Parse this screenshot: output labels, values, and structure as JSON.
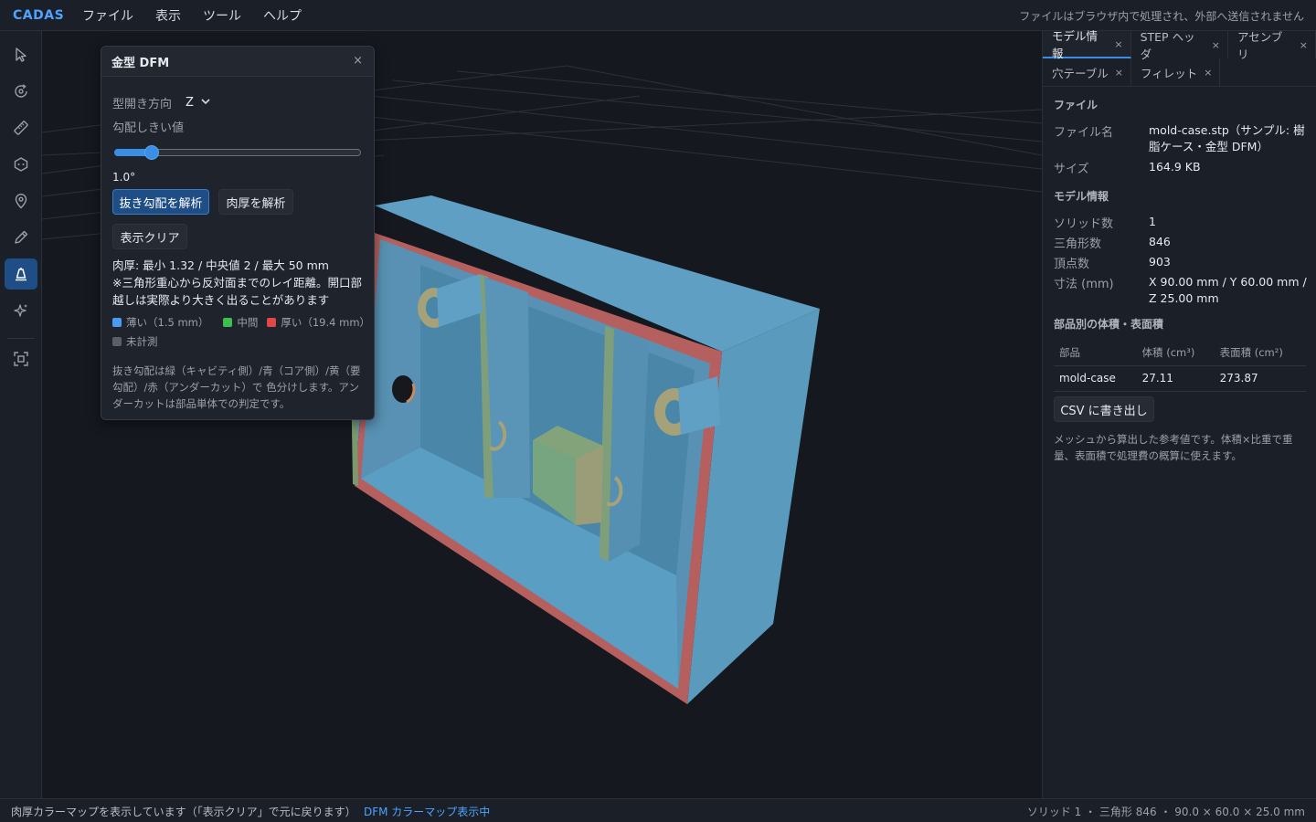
{
  "app": {
    "brand": "CADAS",
    "menus": [
      "ファイル",
      "表示",
      "ツール",
      "ヘルプ"
    ],
    "privacy_note": "ファイルはブラウザ内で処理され、外部へ送信されません"
  },
  "toolbar": {
    "tools": [
      {
        "name": "select-tool",
        "icon": "cursor-icon"
      },
      {
        "name": "orbit-tool",
        "icon": "orbit-icon"
      },
      {
        "name": "measure-tool",
        "icon": "ruler-icon"
      },
      {
        "name": "section-tool",
        "icon": "section-icon"
      },
      {
        "name": "marker-tool",
        "icon": "pin-icon"
      },
      {
        "name": "annotate-tool",
        "icon": "pencil-icon"
      },
      {
        "name": "dfm-tool",
        "icon": "mold-icon",
        "active": true
      },
      {
        "name": "ai-tool",
        "icon": "sparkle-icon"
      },
      {
        "name": "fit-tool",
        "icon": "fit-view-icon"
      }
    ]
  },
  "dfm": {
    "title": "金型 DFM",
    "close": "×",
    "direction_label": "型開き方向",
    "direction_value": "Z",
    "threshold_label": "勾配しきい値",
    "threshold_value": "1.0°",
    "threshold_fraction": 0.13,
    "btn_draft": "抜き勾配を解析",
    "btn_thickness": "肉厚を解析",
    "btn_clear": "表示クリア",
    "stats_line1": "肉厚: 最小 1.32 / 中央値 2 / 最大 50 mm",
    "stats_line2": "※三角形重心から反対面までのレイ距離。開口部越しは実際より大きく出ることがあります",
    "legend": {
      "thin": "薄い（1.5 mm）",
      "mid": "中間",
      "thick": "厚い（19.4 mm）",
      "none": "未計測"
    },
    "note": "抜き勾配は緑（キャビティ側）/青（コア側）/黄（要勾配）/赤（アンダーカット）で 色分けします。アンダーカットは部品単体での判定です。"
  },
  "panel": {
    "tabs_row1": [
      {
        "label": "モデル情報",
        "active": true
      },
      {
        "label": "STEP ヘッダ"
      },
      {
        "label": "アセンブリ"
      }
    ],
    "tabs_row2": [
      {
        "label": "穴テーブル"
      },
      {
        "label": "フィレット"
      }
    ],
    "tab_close": "×",
    "section_file": "ファイル",
    "file_name_label": "ファイル名",
    "file_name_value": "mold-case.stp（サンプル: 樹脂ケース・金型 DFM）",
    "size_label": "サイズ",
    "size_value": "164.9 KB",
    "section_model": "モデル情報",
    "solids_label": "ソリッド数",
    "solids_value": "1",
    "tris_label": "三角形数",
    "tris_value": "846",
    "verts_label": "頂点数",
    "verts_value": "903",
    "dims_label": "寸法 (mm)",
    "dims_value": "X 90.00 mm / Y 60.00 mm / Z 25.00 mm",
    "section_parts": "部品別の体積・表面積",
    "parts_headers": [
      "部品",
      "体積 (cm³)",
      "表面積 (cm²)"
    ],
    "parts_rows": [
      [
        "mold-case",
        "27.11",
        "273.87"
      ]
    ],
    "csv_button": "CSV に書き出し",
    "note": "メッシュから算出した参考値です。体積×比重で重量、表面積で処理費の概算に使えます。"
  },
  "status": {
    "left": "肉厚カラーマップを表示しています（「表示クリア」で元に戻ります）",
    "mode": "DFM カラーマップ表示中",
    "right": "ソリッド 1 ・ 三角形 846 ・ 90.0 × 60.0 × 25.0 mm"
  },
  "colors": {
    "accent": "#3a8ee6",
    "thin": "#4a9bf0",
    "mid": "#3cbf4f",
    "thick": "#e04848",
    "none": "#5a5f68",
    "model_body": "#5fa0c4",
    "model_rim": "#b5605e"
  }
}
